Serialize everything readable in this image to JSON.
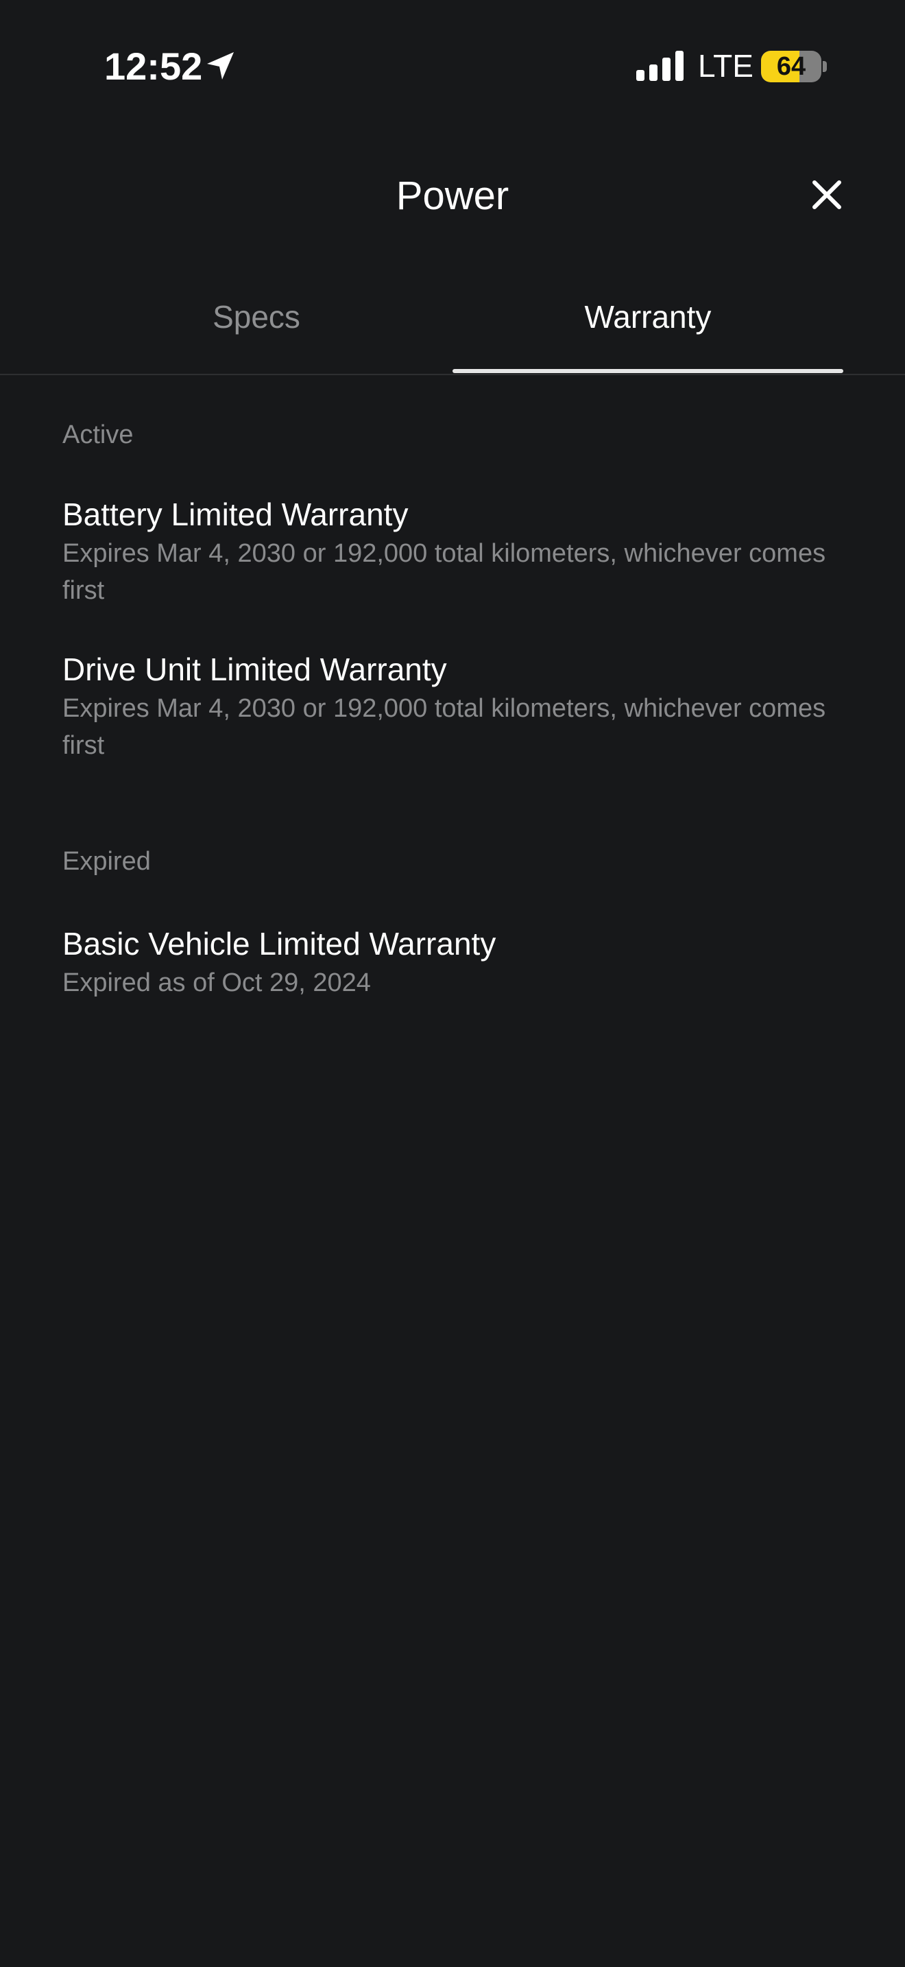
{
  "status_bar": {
    "time": "12:52",
    "network": "LTE",
    "battery_level": "64",
    "battery_fraction": 0.64
  },
  "header": {
    "title": "Power"
  },
  "tabs": [
    {
      "label": "Specs",
      "active": false
    },
    {
      "label": "Warranty",
      "active": true
    }
  ],
  "sections": {
    "active": {
      "label": "Active",
      "items": [
        {
          "title": "Battery Limited Warranty",
          "detail": "Expires Mar 4, 2030 or 192,000 total kilometers, whichever comes first"
        },
        {
          "title": "Drive Unit Limited Warranty",
          "detail": "Expires Mar 4, 2030 or 192,000 total kilometers, whichever comes first"
        }
      ]
    },
    "expired": {
      "label": "Expired",
      "items": [
        {
          "title": "Basic Vehicle Limited Warranty",
          "detail": "Expired as of Oct 29, 2024"
        }
      ]
    }
  },
  "colors": {
    "background": "#17181a",
    "battery_accent": "#f7d216",
    "secondary_text": "#8a8b8d",
    "tab_indicator": "#e6e6e6"
  },
  "icons": {
    "location": "location-arrow-icon",
    "signal": "cellular-signal-icon",
    "close": "close-icon"
  }
}
